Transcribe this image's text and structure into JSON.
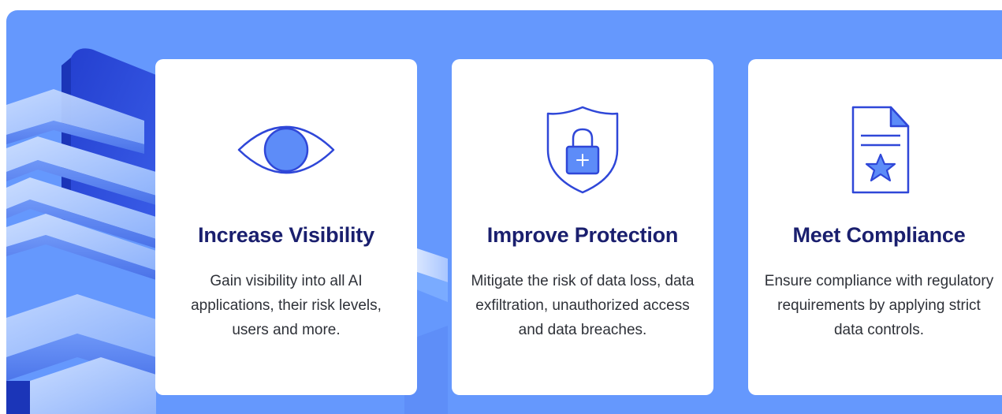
{
  "colors": {
    "background": "#6598fd",
    "card": "#ffffff",
    "heading": "#1a1f6e",
    "body_text": "#2e3138",
    "icon_stroke": "#2f47d8",
    "icon_fill": "#5d8cf8"
  },
  "cards": [
    {
      "icon": "eye-icon",
      "title": "Increase Visibility",
      "description": "Gain visibility into all AI applications, their risk levels, users and more."
    },
    {
      "icon": "shield-lock-icon",
      "title": "Improve Protection",
      "description": "Mitigate the risk of data loss, data exfiltration, unauthorized access and data breaches."
    },
    {
      "icon": "certificate-document-icon",
      "title": "Meet Compliance",
      "description": "Ensure compliance with regulatory requirements by applying strict data controls."
    }
  ]
}
